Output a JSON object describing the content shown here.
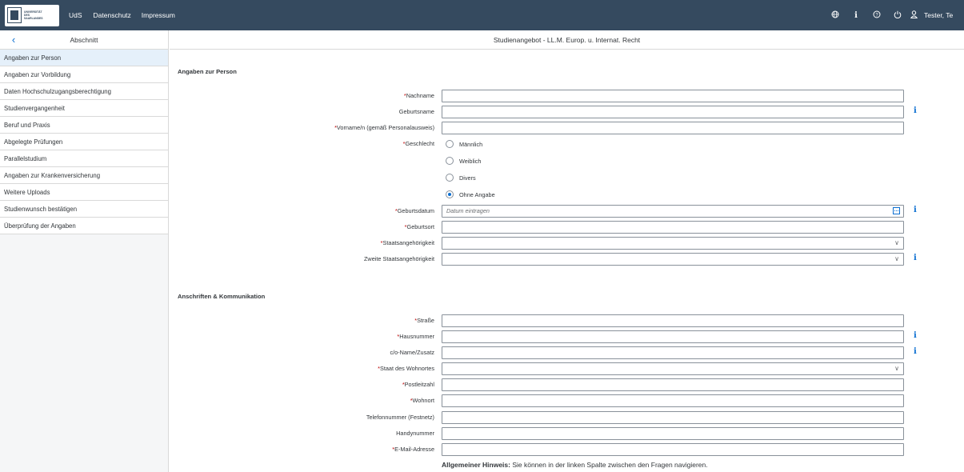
{
  "topbar": {
    "logo_text": "UNIVERSITÄT DES SAARLANDES",
    "nav": [
      "UdS",
      "Datenschutz",
      "Impressum"
    ],
    "icons": [
      "globe-icon",
      "info-icon",
      "help-icon",
      "power-icon",
      "user-icon"
    ],
    "user": "Tester, Te"
  },
  "left": {
    "title": "Abschnitt",
    "sections": [
      "Angaben zur Person",
      "Angaben zur Vorbildung",
      "Daten Hochschulzugangsberechtigung",
      "Studienvergangenheit",
      "Beruf und Praxis",
      "Abgelegte Prüfungen",
      "Parallelstudium",
      "Angaben zur Krankenversicherung",
      "Weitere Uploads",
      "Studienwunsch bestätigen",
      "Überprüfung der Angaben"
    ],
    "active_index": 0
  },
  "main": {
    "header": "Studienangebot - LL.M. Europ. u. Internat. Recht",
    "person": {
      "title": "Angaben zur Person",
      "nachname": "Nachname",
      "geburtsname": "Geburtsname",
      "vorname": "Vorname/n (gemäß Personalausweis)",
      "geschlecht": "Geschlecht",
      "options": [
        "Männlich",
        "Weiblich",
        "Divers",
        "Ohne Angabe"
      ],
      "selected": "Ohne Angabe",
      "geburtsdatum": "Geburtsdatum",
      "geburtsdatum_placeholder": "Datum eintragen",
      "geburtsort": "Geburtsort",
      "staat": "Staatsangehörigkeit",
      "zweite_staat": "Zweite Staatsangehörigkeit"
    },
    "address": {
      "title": "Anschriften & Kommunikation",
      "strasse": "Straße",
      "hausnummer": "Hausnummer",
      "co": "c/o-Name/Zusatz",
      "staat_wohnort": "Staat des Wohnortes",
      "plz": "Postleitzahl",
      "wohnort": "Wohnort",
      "telefon": "Telefonnummer (Festnetz)",
      "handy": "Handynummer",
      "email": "E-Mail-Adresse"
    },
    "hint_bold": "Allgemeiner Hinweis:",
    "hint_text": " Sie können in der linken Spalte zwischen den Fragen navigieren.",
    "required_mark": "*"
  }
}
